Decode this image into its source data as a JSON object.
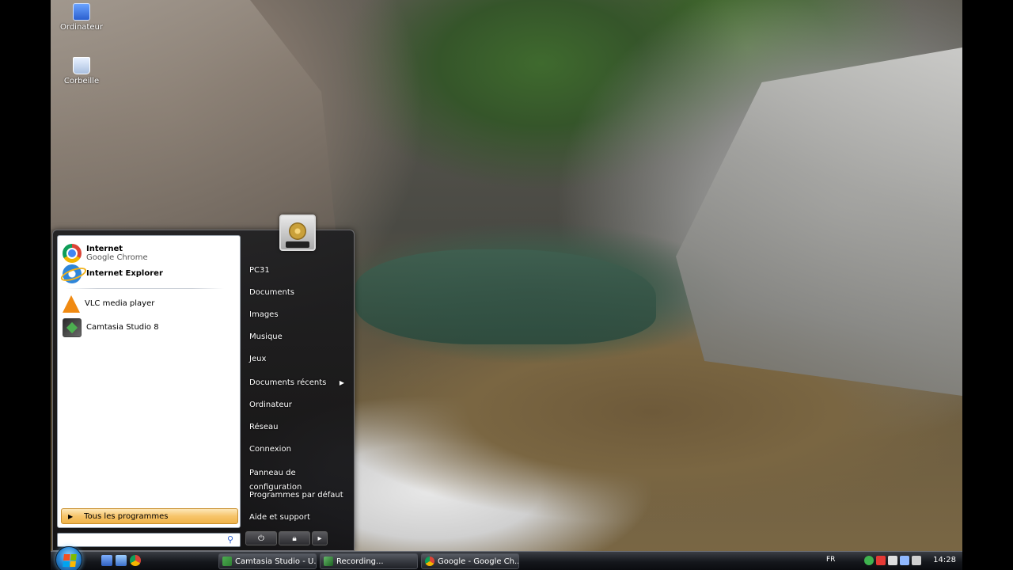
{
  "desktop": {
    "icons": [
      {
        "label": "Ordinateur",
        "icon": "computer-icon"
      },
      {
        "label": "Corbeille",
        "icon": "recycle-bin-icon"
      }
    ]
  },
  "start_menu": {
    "pinned": [
      {
        "title": "Internet",
        "subtitle": "Google Chrome",
        "icon": "chrome-icon"
      },
      {
        "title": "Internet Explorer",
        "icon": "internet-explorer-icon"
      }
    ],
    "recent": [
      {
        "title": "VLC media player",
        "icon": "vlc-icon"
      },
      {
        "title": "Camtasia Studio 8",
        "icon": "camtasia-icon"
      }
    ],
    "all_programs": "Tous les programmes",
    "search": {
      "value": "",
      "icon": "search-icon"
    },
    "right_links": [
      "PC31",
      "Documents",
      "Images",
      "Musique",
      "Jeux",
      "Documents récents",
      "Ordinateur",
      "Réseau",
      "Connexion",
      "Panneau de configuration",
      "Programmes par défaut",
      "Aide et support"
    ],
    "power_icons": [
      "power-icon",
      "lock-icon",
      "chevron-right-icon"
    ]
  },
  "taskbar": {
    "start_icon": "windows-start-orb-icon",
    "quick_launch": [
      "show-desktop-icon",
      "switch-windows-icon",
      "chrome-icon"
    ],
    "tasks": [
      {
        "label": "Camtasia Studio - U...",
        "icon": "camtasia-icon"
      },
      {
        "label": "Recording...",
        "icon": "recording-icon"
      },
      {
        "label": "Google - Google Ch...",
        "icon": "chrome-icon"
      }
    ],
    "language": "FR",
    "clock": "14:28"
  }
}
